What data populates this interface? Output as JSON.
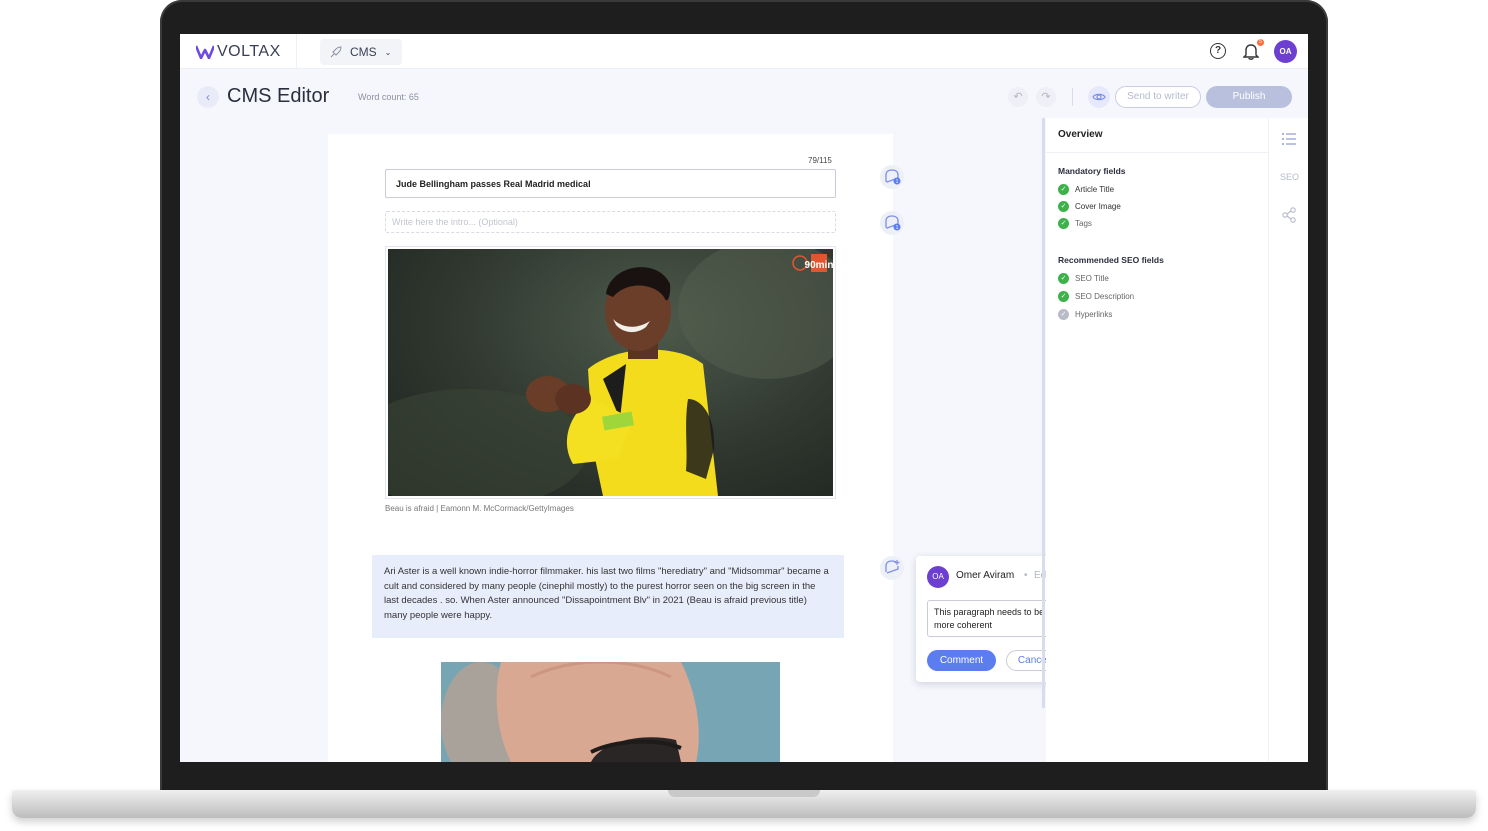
{
  "app": {
    "logo_text": "VOLTAX",
    "product_selector": "CMS",
    "notification_count": "5",
    "user_initials": "OA"
  },
  "header": {
    "title": "CMS Editor",
    "word_count": "Word count: 65",
    "send_to_writer": "Send to writer",
    "publish": "Publish"
  },
  "editor": {
    "title_char_count": "79/115",
    "article_title": "Jude Bellingham passes Real Madrid medical",
    "intro_placeholder": "Write here the intro... (Optional)",
    "comment_counts": [
      "1",
      "1"
    ],
    "image_watermark": "90min",
    "image_caption": "Beau is afraid | Eamonn M. McCormack/GettyImages",
    "paragraph": "Ari Aster is a well known indie-horror filmmaker. his last two films \"herediatry\" and \"Midsommar\" became a cult and considered by many people (cinephil mostly) to the purest horror seen on the big screen in the last decades . so. When Aster announced \"Dissapointment Blv\" in 2021 (Beau is afraid previous title) many people were happy."
  },
  "comment": {
    "initials": "OA",
    "author": "Omer Aviram",
    "role": "Editor",
    "text": "This paragraph needs to be made more coherent",
    "submit": "Comment",
    "cancel": "Cancel"
  },
  "overview": {
    "title": "Overview",
    "mandatory_title": "Mandatory fields",
    "mandatory": [
      {
        "label": "Article Title",
        "done": true
      },
      {
        "label": "Cover Image",
        "done": true
      },
      {
        "label": "Tags",
        "done": true
      }
    ],
    "seo_title": "Recommended SEO fields",
    "seo": [
      {
        "label": "SEO Title",
        "done": true
      },
      {
        "label": "SEO Description",
        "done": true
      },
      {
        "label": "Hyperlinks",
        "done": false
      }
    ]
  },
  "side_tabs": {
    "seo_label": "SEO"
  },
  "colors": {
    "accent": "#5b7df0",
    "avatar": "#6c3fd1",
    "check_green": "#3db24a",
    "kit_yellow": "#f4df1c"
  }
}
